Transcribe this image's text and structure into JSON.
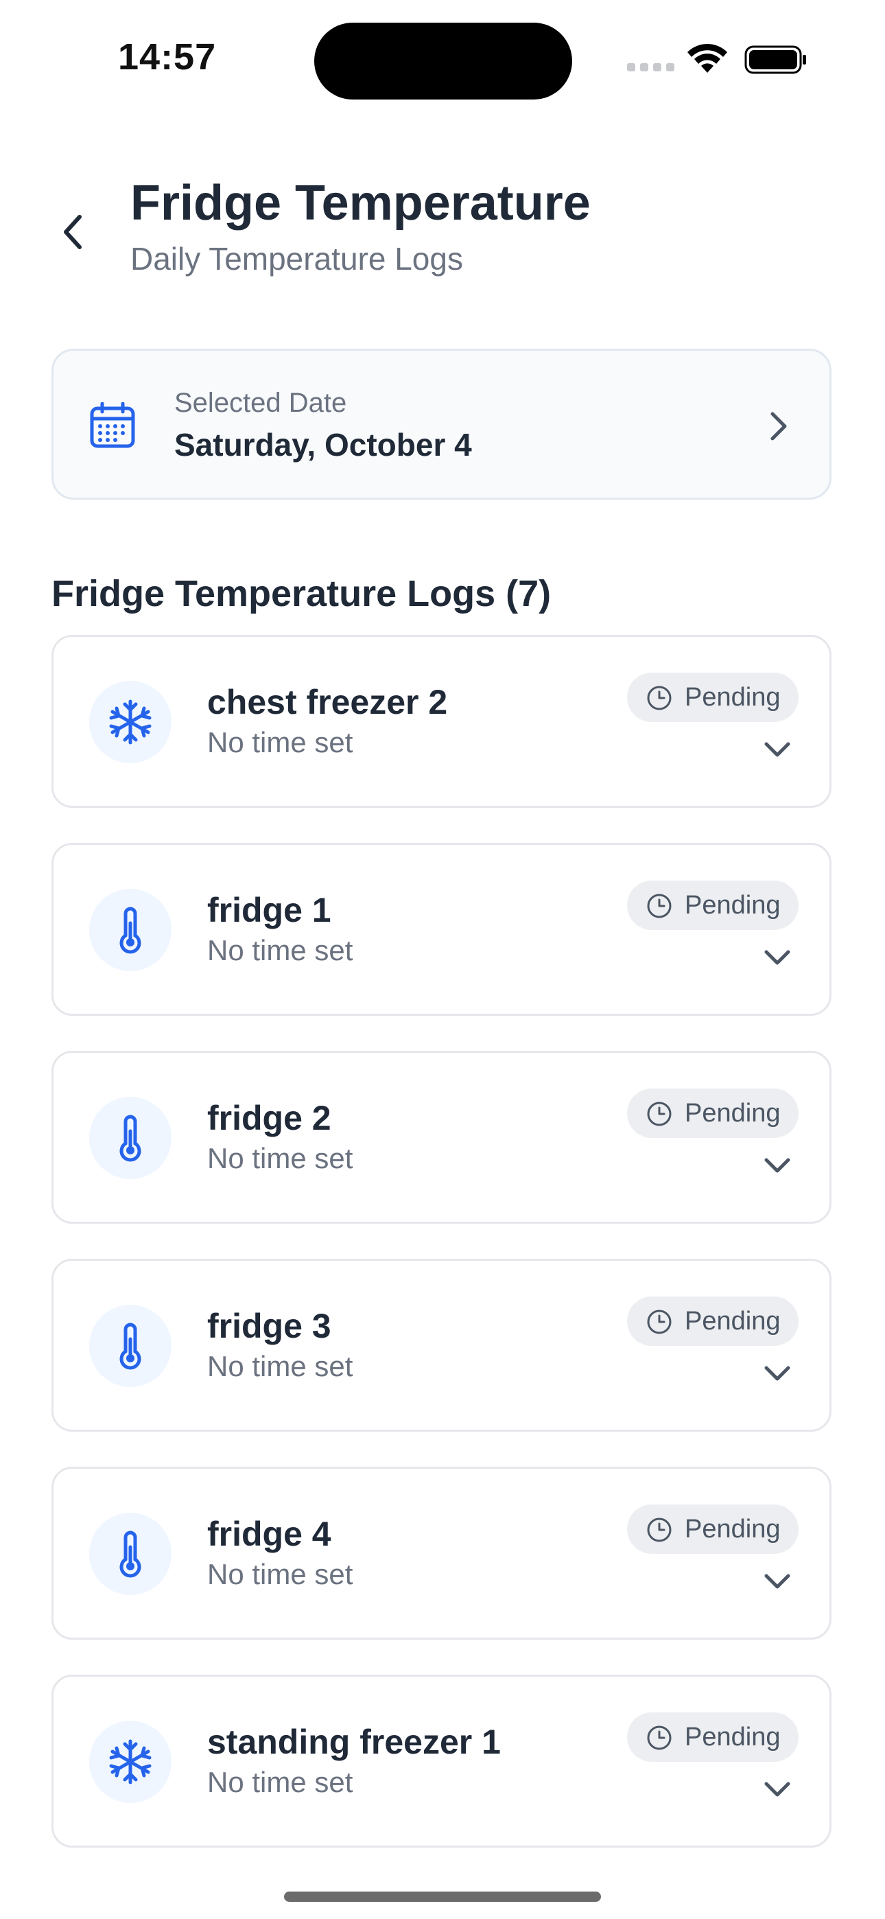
{
  "status_bar": {
    "time": "14:57"
  },
  "header": {
    "title": "Fridge Temperature",
    "subtitle": "Daily Temperature Logs"
  },
  "date_selector": {
    "label": "Selected Date",
    "value": "Saturday, October 4"
  },
  "logs_section": {
    "title": "Fridge Temperature Logs (7)"
  },
  "logs": [
    {
      "name": "chest freezer 2",
      "time": "No time set",
      "status": "Pending",
      "icon": "snowflake-icon"
    },
    {
      "name": "fridge 1",
      "time": "No time set",
      "status": "Pending",
      "icon": "thermometer-icon"
    },
    {
      "name": "fridge 2",
      "time": "No time set",
      "status": "Pending",
      "icon": "thermometer-icon"
    },
    {
      "name": "fridge 3",
      "time": "No time set",
      "status": "Pending",
      "icon": "thermometer-icon"
    },
    {
      "name": "fridge 4",
      "time": "No time set",
      "status": "Pending",
      "icon": "thermometer-icon"
    },
    {
      "name": "standing freezer 1",
      "time": "No time set",
      "status": "Pending",
      "icon": "snowflake-icon"
    }
  ],
  "colors": {
    "accent": "#2563eb",
    "icon_bg": "#eff6ff",
    "badge_bg": "#eceef1",
    "card_border": "#e5e7eb"
  }
}
